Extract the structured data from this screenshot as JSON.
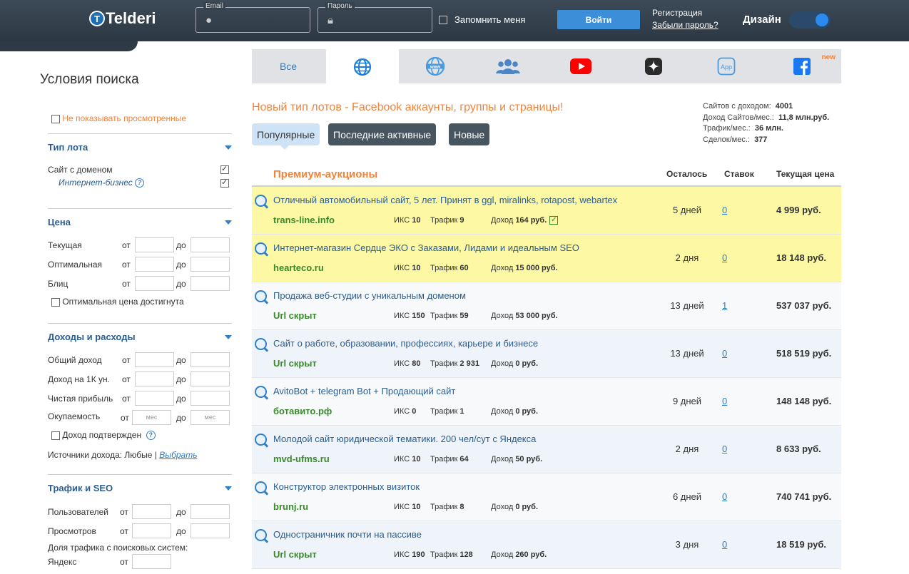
{
  "header": {
    "logo": "Telderi",
    "email_label": "Email",
    "password_label": "Пароль",
    "remember_label": "Запомнить меня",
    "login_button": "Войти",
    "register_link": "Регистрация",
    "forgot_link": "Забыли пароль?",
    "design_label": "Дизайн"
  },
  "sidebar": {
    "title": "Условия поиска",
    "hide_viewed": "Не показывать просмотренные",
    "lot_type": {
      "heading": "Тип лота",
      "site_with_domain": "Сайт с доменом",
      "internet_business": "Интернет-бизнес"
    },
    "price": {
      "heading": "Цена",
      "current": "Текущая",
      "optimal": "Оптимальная",
      "blitz": "Блиц",
      "optimal_reached": "Оптимальная цена достигнута",
      "from": "от",
      "to": "до"
    },
    "income": {
      "heading": "Доходы и расходы",
      "total_income": "Общий доход",
      "income_per_1k": "Доход на 1К ун.",
      "net_profit": "Чистая прибыль",
      "payback": "Окупаемость",
      "months_placeholder": "мес",
      "income_confirmed": "Доход подтвержден",
      "sources_label": "Источники дохода: Любые |",
      "choose_link": "Выбрать"
    },
    "traffic": {
      "heading": "Трафик и SEO",
      "users": "Пользователей",
      "views": "Просмотров",
      "search_share": "Доля трафика с поисковых систем:",
      "yandex": "Яндекс"
    }
  },
  "tabs": {
    "all": "Все",
    "new_badge": "new",
    "app": "App"
  },
  "main": {
    "promo": "Новый тип лотов - Facebook аккаунты, группы и страницы!",
    "stats": {
      "sites_income_label": "Сайтов с доходом:",
      "sites_income_value": "4001",
      "income_month_label": "Доход Сайтов/мес.:",
      "income_month_value": "11,8 млн.руб.",
      "traffic_label": "Трафик/мес.:",
      "traffic_value": "36 млн.",
      "deals_label": "Сделок/мес.:",
      "deals_value": "377"
    },
    "filters": {
      "popular": "Популярные",
      "recent": "Последние активные",
      "new": "Новые"
    },
    "table_headers": {
      "premium": "Премиум-аукционы",
      "remaining": "Осталось",
      "bids": "Ставок",
      "price": "Текущая цена"
    },
    "labels": {
      "iks": "ИКС",
      "traffic": "Трафик",
      "income": "Доход"
    },
    "rows": [
      {
        "title": "Отличный автомобильный сайт, 5 лет. Принят в ggl, miralinks, rotapost, webartex",
        "domain": "trans-line.info",
        "iks": "10",
        "traffic": "9",
        "income": "164 руб.",
        "remaining": "5 дней",
        "bids": "0",
        "price": "4 999 руб."
      },
      {
        "title": "Интернет-магазин Сердце ЭКО с Заказами, Лидами и идеальным SEO",
        "domain": "hearteco.ru",
        "iks": "10",
        "traffic": "60",
        "income": "15 000 руб.",
        "remaining": "2 дня",
        "bids": "0",
        "price": "18 148 руб."
      },
      {
        "title": "Продажа веб-студии с уникальным доменом",
        "domain": "Url скрыт",
        "iks": "150",
        "traffic": "59",
        "income": "53 000 руб.",
        "remaining": "13 дней",
        "bids": "1",
        "price": "537 037 руб."
      },
      {
        "title": "Сайт о работе, образовании, профессиях, карьере и бизнесе",
        "domain": "Url скрыт",
        "iks": "80",
        "traffic": "2 931",
        "income": "0 руб.",
        "remaining": "13 дней",
        "bids": "0",
        "price": "518 519 руб."
      },
      {
        "title": "AvitoBot + telegram Bot + Продающий сайт",
        "domain": "ботавито.рф",
        "iks": "0",
        "traffic": "1",
        "income": "0 руб.",
        "remaining": "9 дней",
        "bids": "0",
        "price": "148 148 руб."
      },
      {
        "title": "Молодой сайт юридической тематики. 200 чел/сут с Яндекса",
        "domain": "mvd-ufms.ru",
        "iks": "10",
        "traffic": "64",
        "income": "50 руб.",
        "remaining": "2 дня",
        "bids": "0",
        "price": "8 633 руб."
      },
      {
        "title": "Конструктор электронных визиток",
        "domain": "brunj.ru",
        "iks": "10",
        "traffic": "8",
        "income": "0 руб.",
        "remaining": "6 дней",
        "bids": "0",
        "price": "740 741 руб."
      },
      {
        "title": "Одностраничник почти на пассиве",
        "domain": "Url скрыт",
        "iks": "190",
        "traffic": "128",
        "income": "260 руб.",
        "remaining": "3 дня",
        "bids": "0",
        "price": "18 519 руб."
      }
    ]
  }
}
